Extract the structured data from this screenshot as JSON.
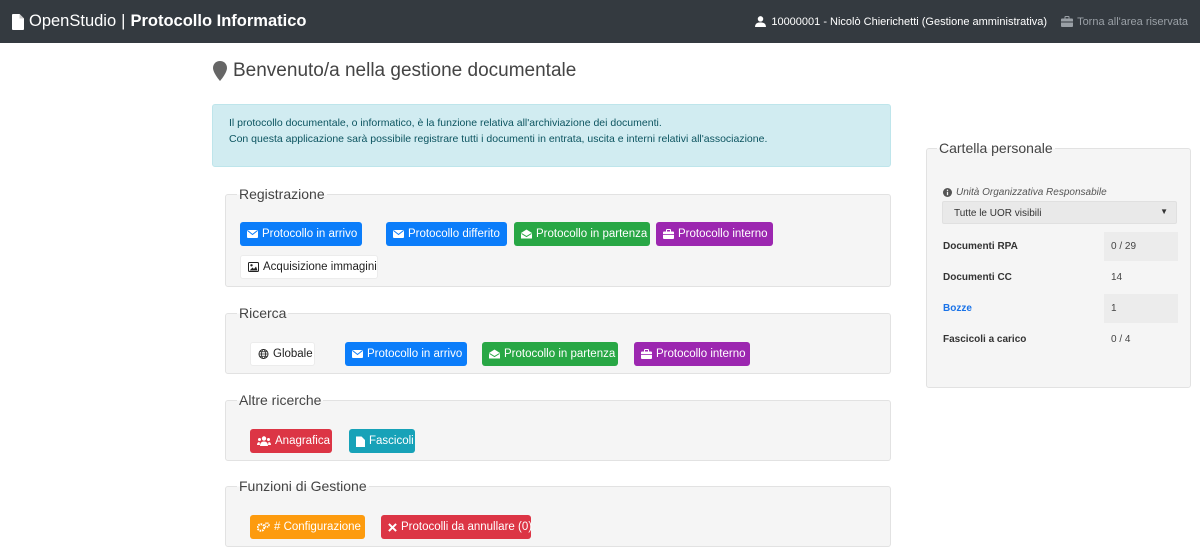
{
  "navbar": {
    "brand": "OpenStudio",
    "separator": "|",
    "app_title": "Protocollo Informatico",
    "user": "10000001 - Nicolò Chierichetti (Gestione amministrativa)",
    "back_link": "Torna all'area riservata"
  },
  "header": {
    "title": "Benvenuto/a nella gestione documentale"
  },
  "info": {
    "line1": "Il protocollo documentale, o informatico, è la funzione relativa all'archiviazione dei documenti.",
    "line2": "Con questa applicazione sarà possibile registrare tutti i documenti in entrata, uscita e interni relativi all'associazione."
  },
  "registrazione": {
    "legend": "Registrazione",
    "buttons": [
      "Protocollo in arrivo",
      "Protocollo differito",
      "Protocollo in partenza",
      "Protocollo interno",
      "Acquisizione immagini"
    ]
  },
  "ricerca": {
    "legend": "Ricerca",
    "buttons": [
      "Globale",
      "Protocollo in arrivo",
      "Protocollo in partenza",
      "Protocollo interno"
    ]
  },
  "altre": {
    "legend": "Altre ricerche",
    "buttons": [
      "Anagrafica",
      "Fascicoli"
    ]
  },
  "funzioni": {
    "legend": "Funzioni di Gestione",
    "buttons": [
      "# Configurazione",
      "Protocolli da annullare (0)"
    ]
  },
  "cartella": {
    "legend": "Cartella personale",
    "uor_label": "Unità Organizzativa Responsabile",
    "uor_selected": "Tutte le UOR visibili",
    "stats": [
      {
        "label": "Documenti RPA",
        "value": "0 / 29"
      },
      {
        "label": "Documenti CC",
        "value": "14"
      },
      {
        "label": "Bozze",
        "value": "1"
      },
      {
        "label": "Fascicoli a carico",
        "value": "0 / 4"
      }
    ]
  },
  "colors": {
    "navbar": "#343a40",
    "primary": "#0b7dfa",
    "success": "#28a745",
    "purple": "#9c27b0",
    "danger": "#dc3545",
    "info": "#17a2b8",
    "warning": "#fd9b0e"
  }
}
